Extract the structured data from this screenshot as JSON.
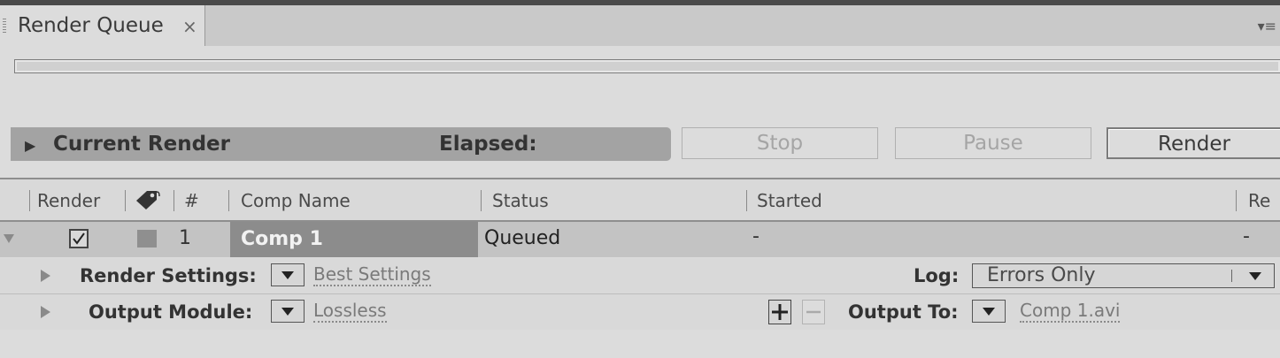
{
  "panel": {
    "tab_title": "Render Queue",
    "tab_close": "×",
    "menu_icon": "panel-menu-icon"
  },
  "current_render": {
    "title": "Current Render",
    "elapsed_label": "Elapsed:"
  },
  "buttons": {
    "stop": "Stop",
    "pause": "Pause",
    "render": "Render"
  },
  "columns": {
    "render": "Render",
    "number": "#",
    "comp_name": "Comp Name",
    "status": "Status",
    "started": "Started",
    "render_time": "Re"
  },
  "queue_item": {
    "index": "1",
    "checked": true,
    "comp_name": "Comp 1",
    "status": "Queued",
    "started": "-",
    "render_time": "-",
    "render_settings_label": "Render Settings:",
    "render_settings_value": "Best Settings",
    "log_label": "Log:",
    "log_value": "Errors Only",
    "output_module_label": "Output Module:",
    "output_module_value": "Lossless",
    "output_to_label": "Output To:",
    "output_to_value": "Comp 1.avi"
  },
  "colors": {
    "label_swatch": "#8f8f8f",
    "selected_row": "#8c8c8c"
  }
}
